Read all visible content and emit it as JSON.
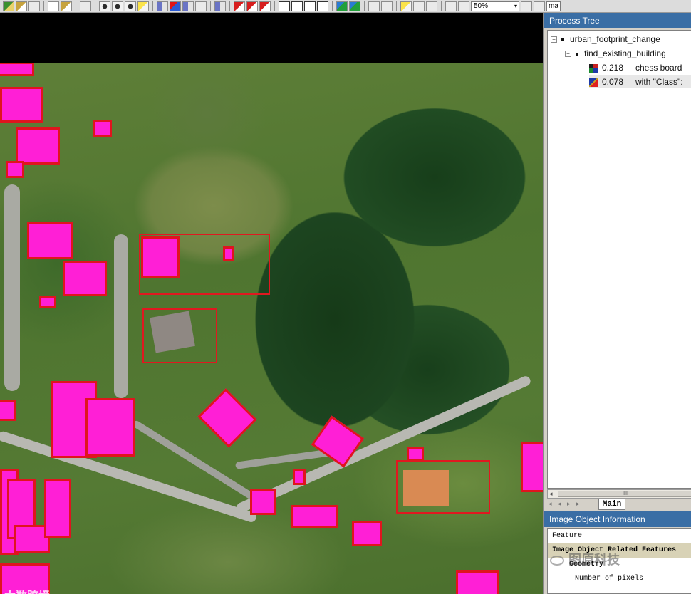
{
  "toolbar": {
    "zoom_value": "50%",
    "name_field": "ma"
  },
  "process_tree": {
    "title": "Process Tree",
    "items": [
      {
        "label": "urban_footprint_change"
      },
      {
        "label": "find_existing_building"
      },
      {
        "time": "0.218",
        "label": "chess board"
      },
      {
        "time": "0.078",
        "label": "with \"Class\":"
      }
    ],
    "scroll_thumb": "III",
    "tab_label": "Main",
    "tab_nav": "◂ ◂ ▸ ▸"
  },
  "image_object_info": {
    "title": "Image Object Information",
    "header": "Feature",
    "group": "Image Object Related Features",
    "subgroup": "Geometry",
    "leaf": "Number of pixels"
  },
  "watermarks": {
    "left": "大数跨境",
    "right": "图原科技"
  },
  "colors": {
    "building_fill": "#ff1fd6",
    "building_outline": "#e0141e",
    "detection_box": "#e01820",
    "panel_title_bar": "#3a6ea5"
  }
}
